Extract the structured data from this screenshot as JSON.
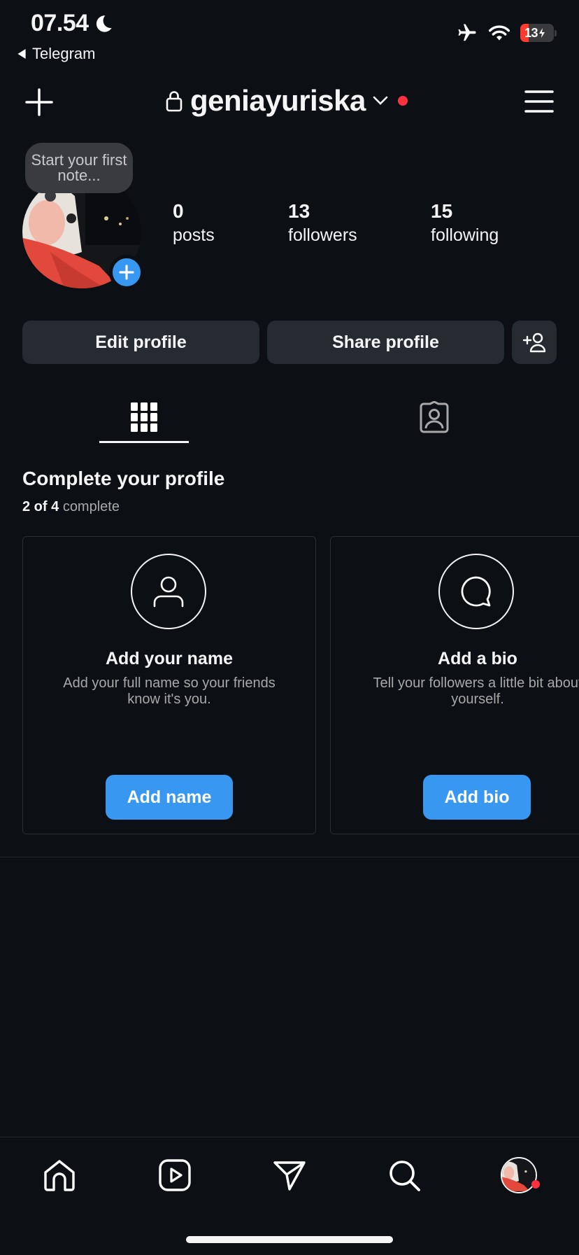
{
  "status_bar": {
    "time": "07.54",
    "back_app": "Telegram",
    "battery": "13"
  },
  "header": {
    "username": "geniayuriska"
  },
  "profile": {
    "note_placeholder": "Start your first note...",
    "stats": [
      {
        "value": "0",
        "label": "posts"
      },
      {
        "value": "13",
        "label": "followers"
      },
      {
        "value": "15",
        "label": "following"
      }
    ]
  },
  "actions": {
    "edit_profile": "Edit profile",
    "share_profile": "Share profile"
  },
  "complete_profile": {
    "title": "Complete your profile",
    "progress_count": "2 of 4",
    "progress_suffix": "complete",
    "cards": [
      {
        "title": "Add your name",
        "description": "Add your full name so your friends know it's you.",
        "button": "Add name"
      },
      {
        "title": "Add a bio",
        "description": "Tell your followers a little bit about yourself.",
        "button": "Add bio"
      }
    ]
  },
  "colors": {
    "background": "#0c0f14",
    "accent": "#3897f0",
    "notification": "#ff3040",
    "button_bg": "#262a31"
  },
  "icons": [
    "moon-icon",
    "back-arrow-icon",
    "airplane-icon",
    "wifi-icon",
    "battery-icon",
    "plus-icon",
    "lock-icon",
    "chevron-down-icon",
    "menu-icon",
    "add-person-icon",
    "grid-icon",
    "tagged-icon",
    "person-icon",
    "chat-bubble-icon",
    "home-icon",
    "reels-icon",
    "send-icon",
    "search-icon"
  ]
}
